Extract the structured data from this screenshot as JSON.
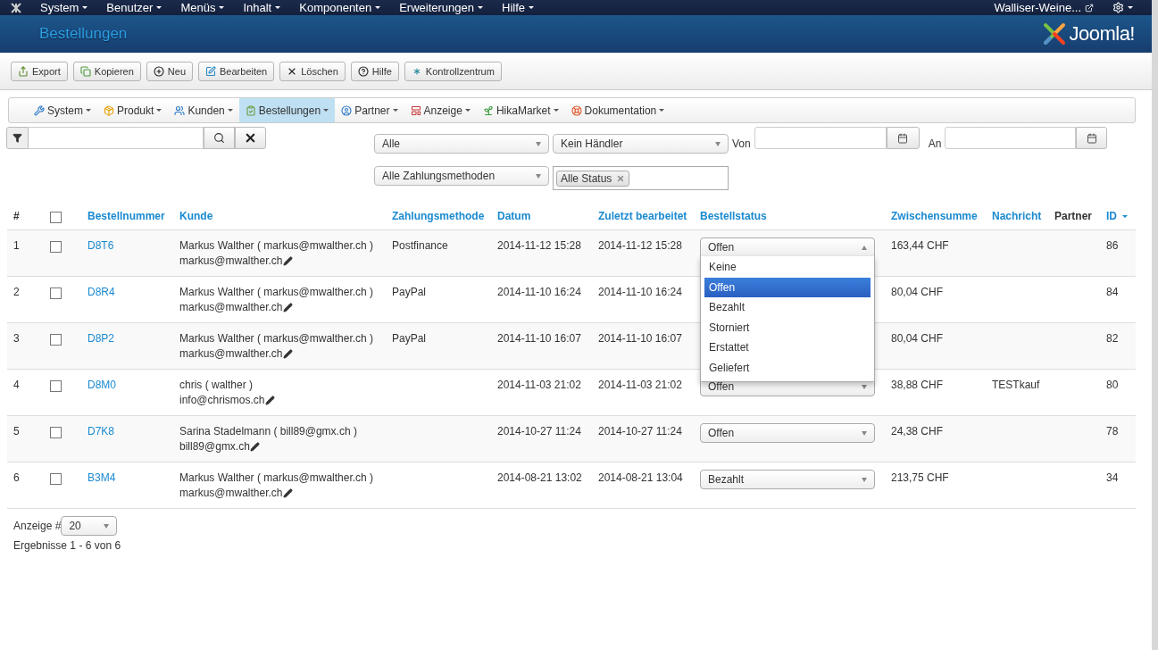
{
  "top_menu": {
    "items": [
      "System",
      "Benutzer",
      "Menüs",
      "Inhalt",
      "Komponenten",
      "Erweiterungen",
      "Hilfe"
    ],
    "site_link": "Walliser-Weine..."
  },
  "header": {
    "title": "Bestellungen",
    "logo_text": "Joomla!"
  },
  "toolbar": [
    "Export",
    "Kopieren",
    "Neu",
    "Bearbeiten",
    "Löschen",
    "Hilfe",
    "Kontrollzentrum"
  ],
  "submenu": [
    {
      "label": "System",
      "selected": false
    },
    {
      "label": "Produkt",
      "selected": false
    },
    {
      "label": "Kunden",
      "selected": false
    },
    {
      "label": "Bestellungen",
      "selected": true
    },
    {
      "label": "Partner",
      "selected": false
    },
    {
      "label": "Anzeige",
      "selected": false
    },
    {
      "label": "HikaMarket",
      "selected": false
    },
    {
      "label": "Dokumentation",
      "selected": false
    }
  ],
  "filters": {
    "type_select": "Alle",
    "vendor_select": "Kein Händler",
    "from_label": "Von",
    "to_label": "An",
    "payment_select": "Alle Zahlungsmethoden",
    "status_tag": "Alle Status"
  },
  "table": {
    "columns": [
      {
        "kind": "text",
        "label": "#",
        "link": false,
        "sorted": false
      },
      {
        "kind": "checkbox",
        "checked": false
      },
      {
        "kind": "text",
        "label": "Bestellnummer",
        "link": true,
        "sorted": false
      },
      {
        "kind": "text",
        "label": "Kunde",
        "link": true,
        "sorted": false
      },
      {
        "kind": "text",
        "label": "Zahlungsmethode",
        "link": true,
        "sorted": false
      },
      {
        "kind": "text",
        "label": "Datum",
        "link": true,
        "sorted": false
      },
      {
        "kind": "text",
        "label": "Zuletzt bearbeitet",
        "link": true,
        "sorted": false
      },
      {
        "kind": "text",
        "label": "Bestellstatus",
        "link": true,
        "sorted": false
      },
      {
        "kind": "text",
        "label": "Zwischensumme",
        "link": true,
        "sorted": false
      },
      {
        "kind": "text",
        "label": "Nachricht",
        "link": true,
        "sorted": false
      },
      {
        "kind": "text",
        "label": "Partner",
        "link": false,
        "sorted": false
      },
      {
        "kind": "text",
        "label": "ID",
        "link": true,
        "sorted": true
      }
    ],
    "rows": [
      {
        "num": "1",
        "checked": false,
        "order": "D8T6",
        "customer": "Markus Walther ( markus@mwalther.ch )",
        "email": "markus@mwalther.ch",
        "payment": "Postfinance",
        "date": "2014-11-12 15:28",
        "modified": "2014-11-12 15:28",
        "status": {
          "value": "Offen",
          "open": true,
          "options": [
            {
              "label": "Keine",
              "selected": false
            },
            {
              "label": "Offen",
              "selected": true
            },
            {
              "label": "Bezahlt",
              "selected": false
            },
            {
              "label": "Storniert",
              "selected": false
            },
            {
              "label": "Erstattet",
              "selected": false
            },
            {
              "label": "Geliefert",
              "selected": false
            }
          ]
        },
        "subtotal": "163,44 CHF",
        "id": "86"
      },
      {
        "num": "2",
        "checked": false,
        "order": "D8R4",
        "customer": "Markus Walther ( markus@mwalther.ch )",
        "email": "markus@mwalther.ch",
        "payment": "PayPal",
        "date": "2014-11-10 16:24",
        "modified": "2014-11-10 16:24",
        "subtotal": "80,04 CHF",
        "id": "84"
      },
      {
        "num": "3",
        "checked": false,
        "order": "D8P2",
        "customer": "Markus Walther ( markus@mwalther.ch )",
        "email": "markus@mwalther.ch",
        "payment": "PayPal",
        "date": "2014-11-10 16:07",
        "modified": "2014-11-10 16:07",
        "subtotal": "80,04 CHF",
        "id": "82"
      },
      {
        "num": "4",
        "checked": false,
        "order": "D8M0",
        "customer": "chris ( walther )",
        "email": "info@chrismos.ch",
        "date": "2014-11-03 21:02",
        "modified": "2014-11-03 21:02",
        "status": {
          "value": "Offen",
          "open": false
        },
        "subtotal": "38,88 CHF",
        "message": "TESTkauf",
        "id": "80"
      },
      {
        "num": "5",
        "checked": false,
        "order": "D7K8",
        "customer": "Sarina Stadelmann ( bill89@gmx.ch )",
        "email": "bill89@gmx.ch",
        "date": "2014-10-27 11:24",
        "modified": "2014-10-27 11:24",
        "status": {
          "value": "Offen",
          "open": false
        },
        "subtotal": "24,38 CHF",
        "id": "78"
      },
      {
        "num": "6",
        "checked": false,
        "order": "B3M4",
        "customer": "Markus Walther ( markus@mwalther.ch )",
        "email": "markus@mwalther.ch",
        "date": "2014-08-21 13:02",
        "modified": "2014-08-21 13:04",
        "status": {
          "value": "Bezahlt",
          "open": false
        },
        "subtotal": "213,75 CHF",
        "id": "34"
      }
    ]
  },
  "footer": {
    "limit_label": "Anzeige #",
    "limit_value": "20",
    "results": "Ergebnisse 1 - 6 von 6"
  }
}
